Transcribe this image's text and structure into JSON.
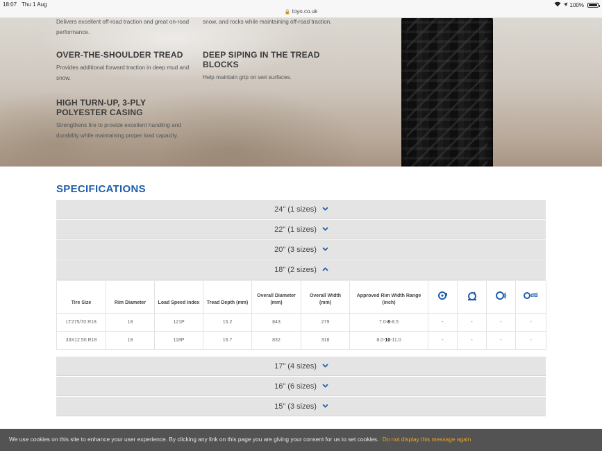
{
  "status": {
    "time": "18:07",
    "date": "Thu 1 Aug",
    "url": "toyo.co.uk",
    "battery": "100%",
    "battery_level": 1.0
  },
  "features": [
    {
      "title": "",
      "desc": "Delivers excellent off-road traction and great on-road performance."
    },
    {
      "title": "",
      "desc": "snow, and rocks while maintaining off-road traction."
    },
    {
      "title": "OVER-THE-SHOULDER TREAD",
      "desc": "Provides additional forward traction in deep mud and snow."
    },
    {
      "title": "DEEP SIPING IN THE TREAD BLOCKS",
      "desc": "Help maintain grip on wet surfaces."
    },
    {
      "title": "HIGH TURN-UP, 3-PLY POLYESTER CASING",
      "desc": "Strengthens tire to provide excellent handling and durability while maintaining proper load capacity."
    }
  ],
  "specifications": {
    "title": "SPECIFICATIONS",
    "sizes_above": [
      {
        "label": "24\" (1 sizes)"
      },
      {
        "label": "22\" (1 sizes)"
      },
      {
        "label": "20\" (3 sizes)"
      },
      {
        "label": "18\" (2 sizes)"
      }
    ],
    "sizes_below": [
      {
        "label": "17\" (4 sizes)"
      },
      {
        "label": "16\" (6 sizes)"
      },
      {
        "label": "15\" (3 sizes)"
      }
    ],
    "columns": [
      "Tire Size",
      "Rim Diameter",
      "Load Speed Index",
      "Tread Depth (mm)",
      "Overall Diameter (mm)",
      "Overall Width (mm)",
      "Approved Rim Width Range (inch)"
    ],
    "icon_columns": [
      "fuel-efficiency-icon",
      "wet-grip-icon",
      "noise-icon",
      "noise-db-icon"
    ],
    "icon_db_text": "dB",
    "rows": [
      {
        "size": "LT275/70 R18",
        "rim": "18",
        "load": "121P",
        "tread": "15.2",
        "diameter": "843",
        "width": "279",
        "rim_min": "7.0-",
        "rim_mid": "8",
        "rim_max": "-8.5",
        "e1": "-",
        "e2": "-",
        "e3": "-",
        "e4": "-"
      },
      {
        "size": "33X12.50 R18",
        "rim": "18",
        "load": "118P",
        "tread": "16.7",
        "diameter": "832",
        "width": "318",
        "rim_min": "8.0-",
        "rim_mid": "10",
        "rim_max": "-11.0",
        "e1": "-",
        "e2": "-",
        "e3": "-",
        "e4": "-"
      }
    ]
  },
  "cookie": {
    "text": "We use cookies on this site to enhance your user experience. By clicking any link on this page you are giving your consent for us to set cookies.",
    "link": "Do not display this message again"
  },
  "colors": {
    "accent": "#1f5ea8",
    "cookie_link": "#f0a31c"
  }
}
